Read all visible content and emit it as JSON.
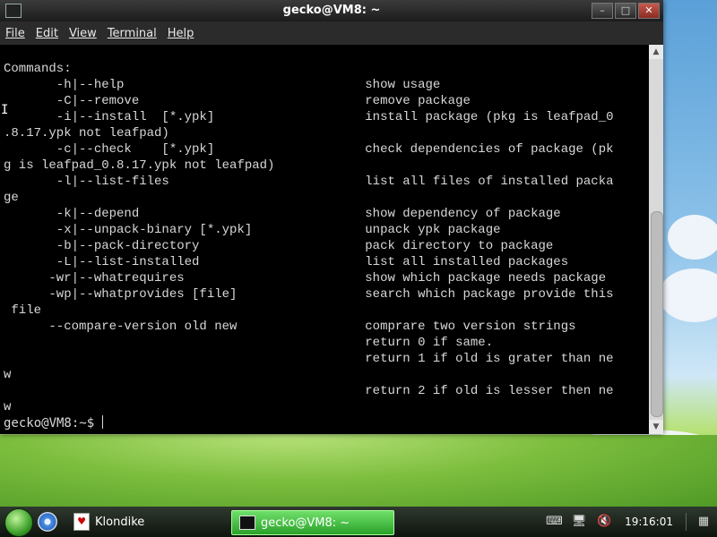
{
  "window": {
    "title": "gecko@VM8: ~",
    "buttons": {
      "minimize": "–",
      "maximize": "□",
      "close": "✕"
    }
  },
  "menu": [
    "File",
    "Edit",
    "View",
    "Terminal",
    "Help"
  ],
  "terminal": {
    "output": "Commands:\n       -h|--help                                show usage\n       -C|--remove                              remove package\n       -i|--install  [*.ypk]                    install package (pkg is leafpad_0\n.8.17.ypk not leafpad)\n       -c|--check    [*.ypk]                    check dependencies of package (pk\ng is leafpad_0.8.17.ypk not leafpad)\n       -l|--list-files                          list all files of installed packa\nge\n       -k|--depend                              show dependency of package\n       -x|--unpack-binary [*.ypk]               unpack ypk package\n       -b|--pack-directory                      pack directory to package\n       -L|--list-installed                      list all installed packages\n      -wr|--whatrequires                        show which package needs package\n      -wp|--whatprovides [file]                 search which package provide this\n file\n      --compare-version old new                 comprare two version strings\n                                                return 0 if same.\n                                                return 1 if old is grater than ne\nw\n                                                return 2 if old is lesser then ne\nw",
    "prompt": "gecko@VM8:~$ "
  },
  "taskbar": {
    "tasks": [
      {
        "label": "Klondike",
        "icon": "cards-icon"
      },
      {
        "label": "gecko@VM8: ~",
        "icon": "terminal-icon",
        "active": true
      }
    ],
    "clock": "19:16:01",
    "colors": {
      "active_task": "#3cb83a",
      "panel": "#1a221a"
    }
  }
}
